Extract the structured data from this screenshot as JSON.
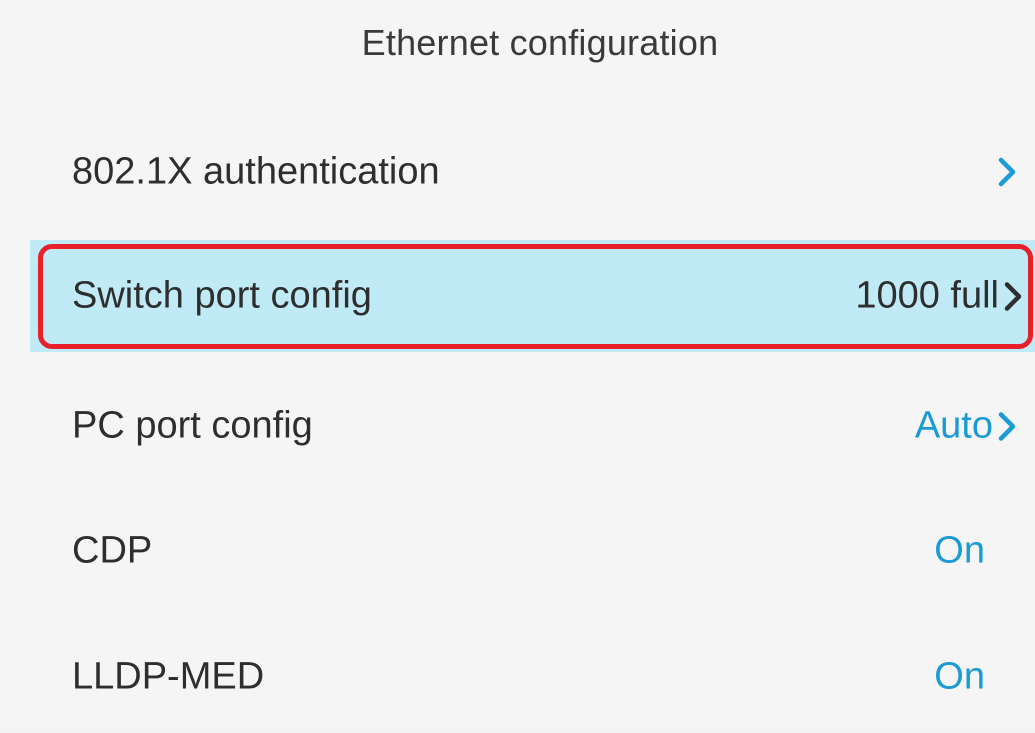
{
  "header": {
    "title": "Ethernet configuration"
  },
  "menu": {
    "items": [
      {
        "label": "802.1X authentication",
        "value": "",
        "chevron": true
      },
      {
        "label": "Switch port config",
        "value": "1000 full",
        "chevron": true,
        "selected": true
      },
      {
        "label": "PC port config",
        "value": "Auto",
        "chevron": true
      },
      {
        "label": "CDP",
        "value": "On",
        "chevron": false
      },
      {
        "label": "LLDP-MED",
        "value": "On",
        "chevron": false
      }
    ]
  },
  "colors": {
    "accent": "#1b9ad6",
    "selected_bg": "#bfeaf6",
    "highlight_border": "#e8202a",
    "background": "#f5f5f5"
  },
  "icons": {
    "chevron": "chevron-right-icon"
  }
}
